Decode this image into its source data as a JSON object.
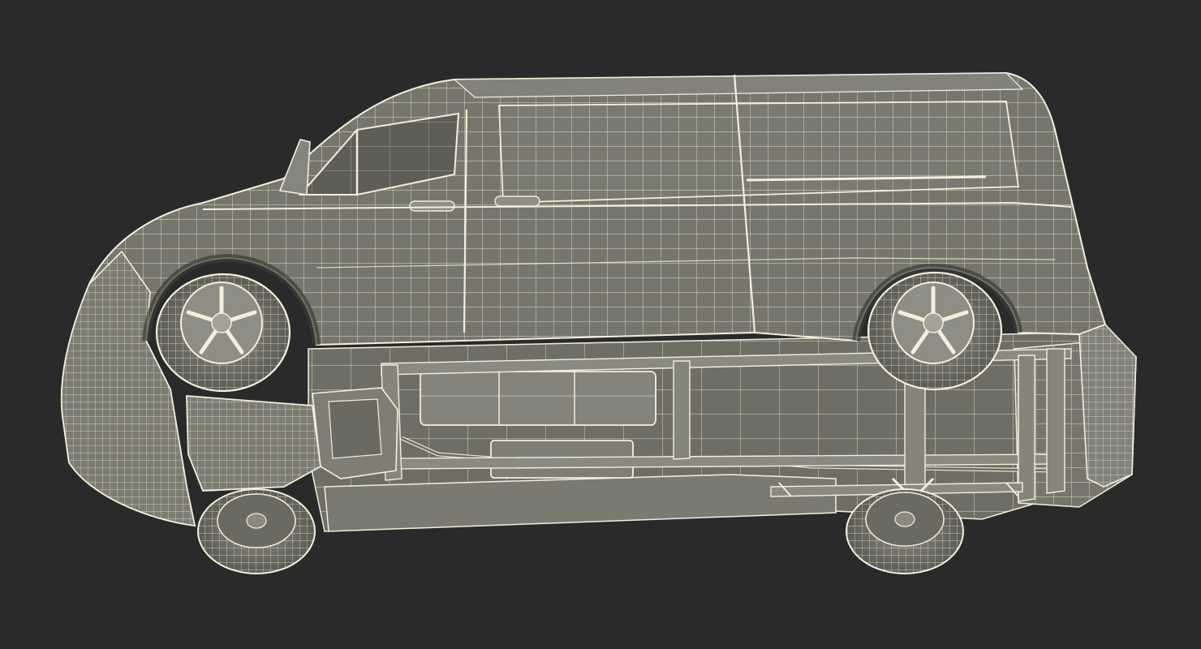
{
  "scene": {
    "subject": "van-wireframe-underside",
    "background_color": "#2a2a2a",
    "body_fill": "#76766c",
    "body_fill_light": "#8a8a80",
    "body_fill_dark": "#5c5c54",
    "wire_color": "#f2f0dc",
    "wire_color_dim": "#d9d7c3",
    "shadow_color": "#3a3a36"
  }
}
